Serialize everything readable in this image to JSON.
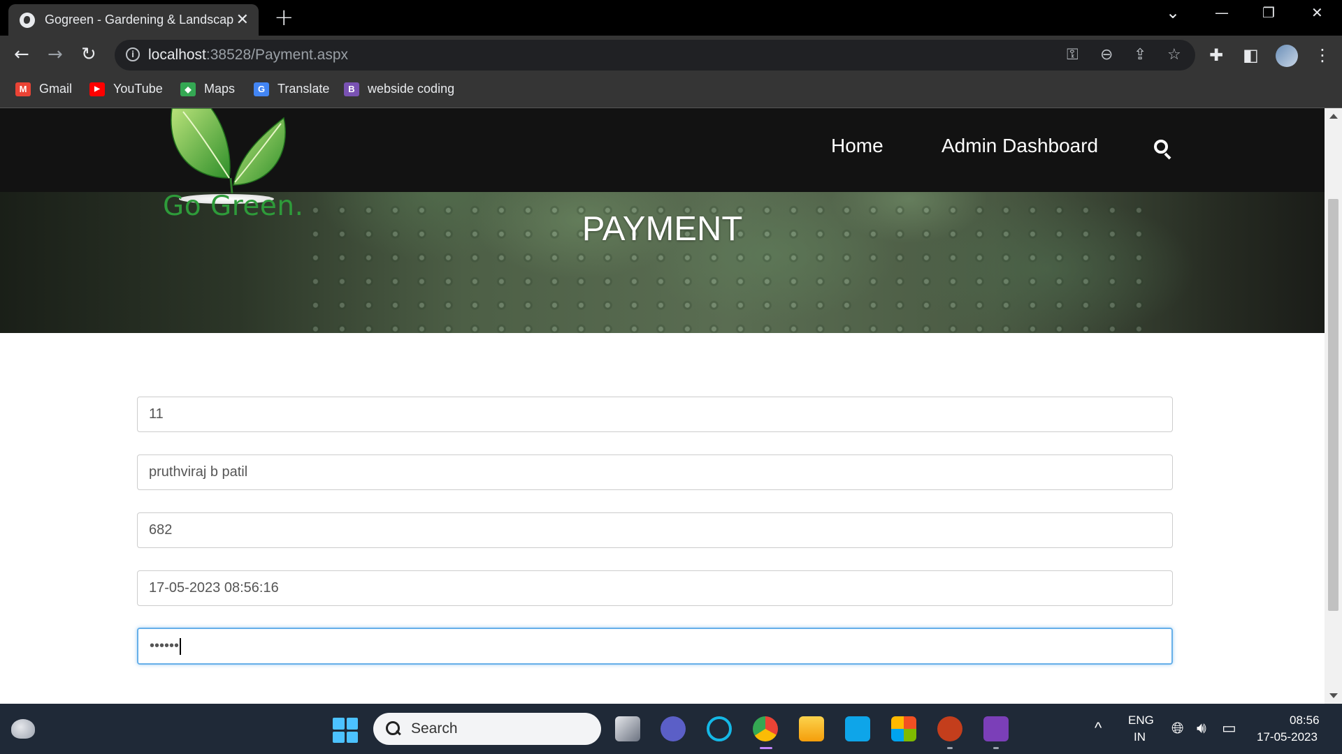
{
  "browser": {
    "tab_title": "Gogreen - Gardening & Landscap",
    "tab_close": "✕",
    "new_tab": "+",
    "url_host": "localhost",
    "url_rest": ":38528/Payment.aspx",
    "window_controls": {
      "dropdown": "⌄",
      "minimize": "—",
      "restore": "❐",
      "close": "✕"
    },
    "bookmarks": [
      {
        "label": "Gmail",
        "icon": "gmail-icon",
        "color": "#ea4335",
        "glyph": "M"
      },
      {
        "label": "YouTube",
        "icon": "youtube-icon",
        "color": "#ff0000",
        "glyph": "▶"
      },
      {
        "label": "Maps",
        "icon": "maps-icon",
        "color": "#34a853",
        "glyph": "◆"
      },
      {
        "label": "Translate",
        "icon": "translate-icon",
        "color": "#4285f4",
        "glyph": "G"
      },
      {
        "label": "webside coding",
        "icon": "bootstrap-icon",
        "color": "#7952b3",
        "glyph": "B"
      }
    ]
  },
  "site": {
    "logo_text": "Go Green.",
    "nav": {
      "home": "Home",
      "admin": "Admin Dashboard"
    },
    "hero_title": "PAYMENT",
    "accent_color": "#2e9b3a"
  },
  "form": {
    "fields": [
      {
        "value": "11"
      },
      {
        "value": "pruthviraj b patil"
      },
      {
        "value": "682"
      },
      {
        "value": "17-05-2023 08:56:16"
      },
      {
        "value": "••••••"
      }
    ]
  },
  "taskbar": {
    "search_label": "Search",
    "lang_top": "ENG",
    "lang_bottom": "IN",
    "time": "08:56",
    "date": "17-05-2023"
  }
}
